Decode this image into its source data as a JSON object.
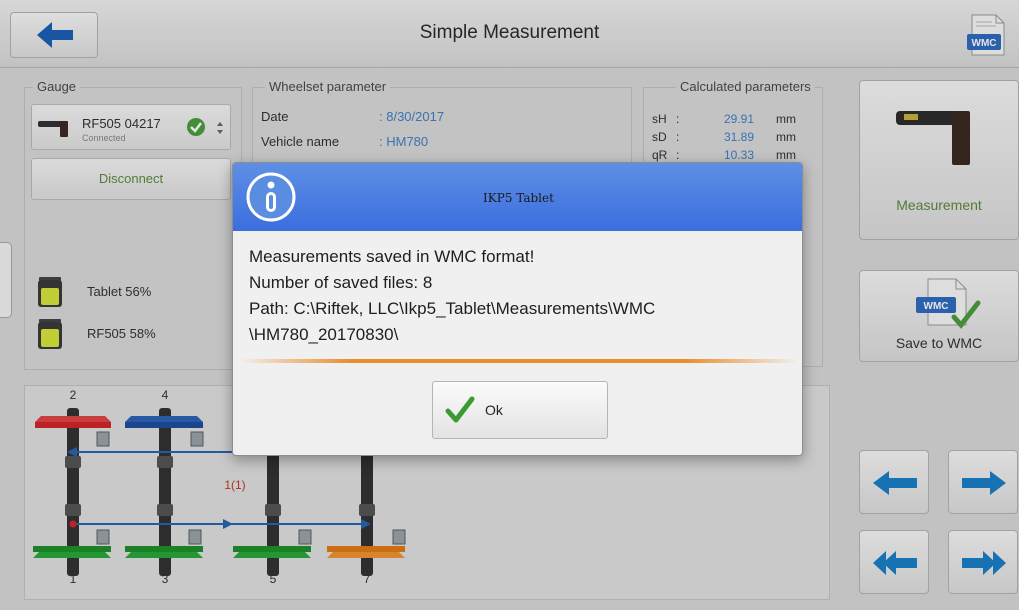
{
  "header": {
    "title": "Simple Measurement",
    "wmc_label": "WMC"
  },
  "gauge": {
    "label": "Gauge",
    "device_name": "RF505 04217",
    "device_status": "Connected",
    "disconnect_label": "Disconnect",
    "batteries": [
      {
        "label": "Tablet 56%",
        "level": 0.56
      },
      {
        "label": "RF505 58%",
        "level": 0.58
      }
    ]
  },
  "wheelset": {
    "label": "Wheelset parameter",
    "rows": [
      {
        "key": "Date",
        "value": ": 8/30/2017"
      },
      {
        "key": "Vehicle name",
        "value": ": HM780"
      }
    ]
  },
  "calculated": {
    "label": "Calculated parameters",
    "rows": [
      {
        "name": "sH",
        "value": "29.91",
        "unit": "mm"
      },
      {
        "name": "sD",
        "value": "31.89",
        "unit": "mm"
      },
      {
        "name": "qR",
        "value": "10.33",
        "unit": "mm"
      }
    ]
  },
  "side": {
    "measurement_label": "Measurement",
    "save_wmc_label": "Save to WMC"
  },
  "diagram": {
    "top_axles": [
      "2",
      "4"
    ],
    "bottom_axles": [
      "1",
      "3",
      "5",
      "7"
    ],
    "annotation": "1(1)",
    "colors": {
      "red": "#d3252a",
      "blue": "#1f4f9e",
      "green": "#1f8f2b",
      "orange": "#e37b16"
    }
  },
  "dialog": {
    "title": "IKP5 Tablet",
    "lines": [
      "Measurements saved in WMC format!",
      "Number of saved files: 8",
      "Path: C:\\Riftek, LLC\\Ikp5_Tablet\\Measurements\\WMC",
      "\\HM780_20170830\\"
    ],
    "ok_label": "Ok"
  },
  "colors": {
    "accent_blue": "#3f7fc6",
    "green_text": "#5d8a3e",
    "dialog_header": "#3b6ede",
    "separator": "#e98f2c"
  }
}
